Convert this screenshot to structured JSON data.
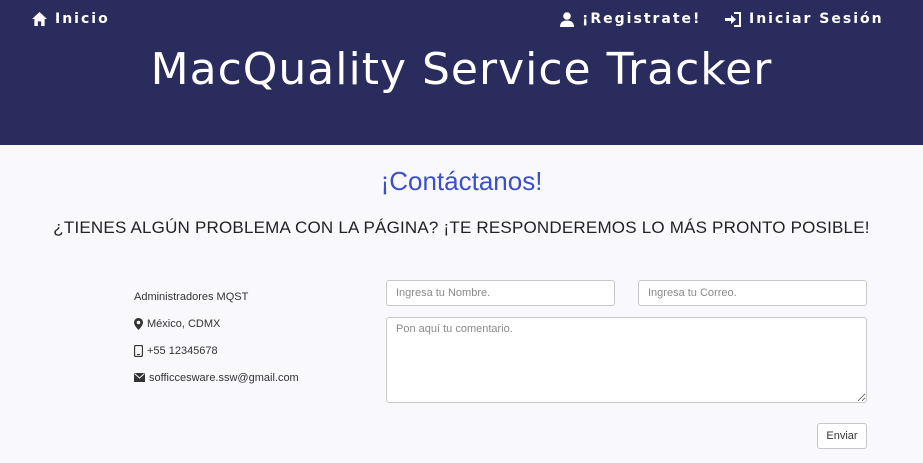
{
  "nav": {
    "home_label": "Inicio",
    "register_label": "¡Registrate!",
    "login_label": "Iniciar Sesión"
  },
  "header": {
    "site_title": "MacQuality Service Tracker"
  },
  "main": {
    "heading": "¡Contáctanos!",
    "subheading": "¿TIENES ALGÚN PROBLEMA CON LA PÁGINA? ¡TE RESPONDEREMOS LO MÁS PRONTO POSIBLE!"
  },
  "contact_info": {
    "name": "Administradores MQST",
    "location": "México, CDMX",
    "phone": "+55 12345678",
    "email": "sofficcesware.ssw@gmail.com"
  },
  "form": {
    "name_placeholder": "Ingresa tu Nombre.",
    "email_placeholder": "Ingresa tu Correo.",
    "comment_placeholder": "Pon aquí tu comentario.",
    "submit_label": "Enviar"
  },
  "colors": {
    "header_bg": "#2a2c5e",
    "heading_blue": "#3a4fc9",
    "page_bg": "#f9f8fd"
  },
  "icons": [
    "home-icon",
    "user-icon",
    "login-icon",
    "map-marker-icon",
    "phone-icon",
    "envelope-icon"
  ]
}
